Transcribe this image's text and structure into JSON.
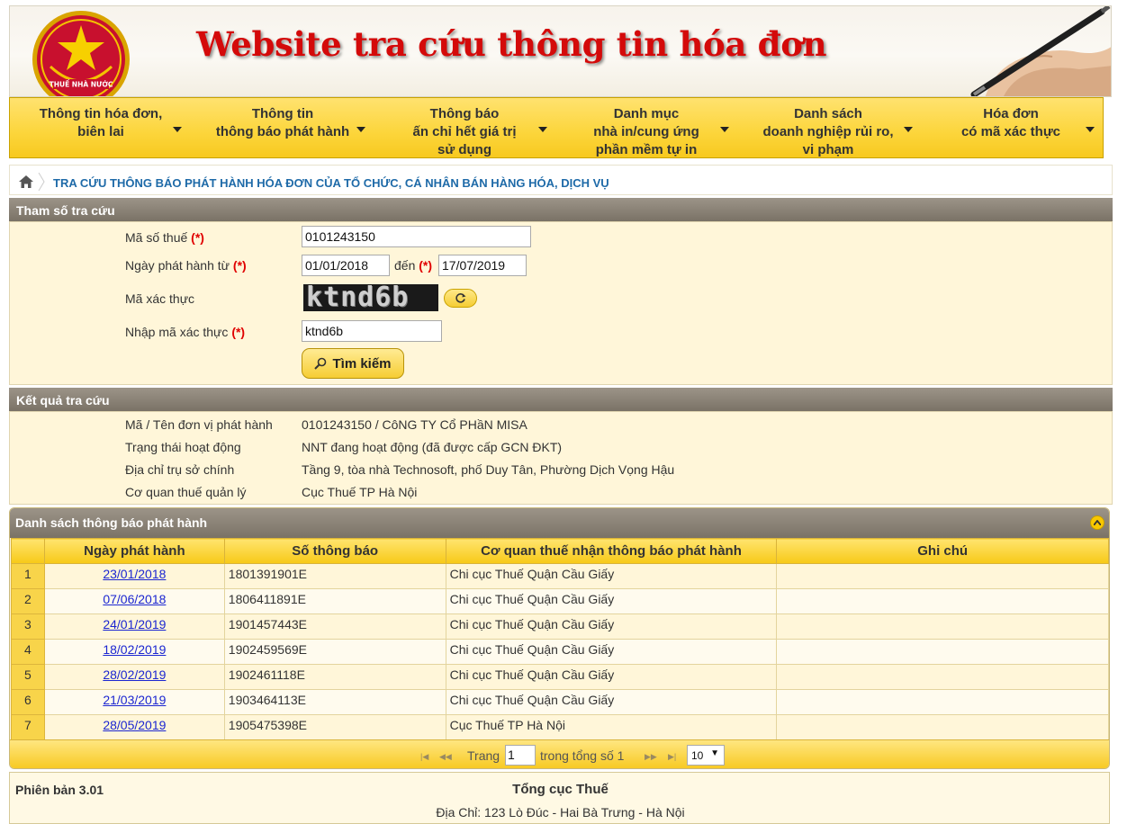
{
  "banner": {
    "title": "Website tra cứu thông tin hóa đơn",
    "emblem_text": "THUẾ NHÀ NƯỚC"
  },
  "nav": [
    {
      "label": "Thông tin hóa đơn,\nbiên lai"
    },
    {
      "label": "Thông tin\nthông báo phát hành"
    },
    {
      "label": "Thông báo\nấn chỉ hết giá trị\nsử dụng"
    },
    {
      "label": "Danh mục\nnhà in/cung ứng\nphần mềm tự in"
    },
    {
      "label": "Danh sách\ndoanh nghiệp rủi ro,\nvi phạm"
    },
    {
      "label": "Hóa đơn\ncó mã xác thực"
    }
  ],
  "breadcrumb": {
    "title": "TRA CỨU THÔNG BÁO PHÁT HÀNH HÓA ĐƠN CỦA TỔ CHỨC, CÁ NHÂN BÁN HÀNG HÓA, DỊCH VỤ"
  },
  "search": {
    "section_title": "Tham số tra cứu",
    "required_mark": "(*)",
    "tax_code_label": "Mã số thuế",
    "tax_code_value": "0101243150",
    "date_from_label": "Ngày phát hành từ",
    "date_from_value": "01/01/2018",
    "date_to_label": "đến",
    "date_to_value": "17/07/2019",
    "captcha_label": "Mã xác thực",
    "captcha_text": "ktnd6b",
    "captcha_input_label": "Nhập mã xác thực",
    "captcha_input_value": "ktnd6b",
    "search_button": "Tìm kiếm"
  },
  "result": {
    "section_title": "Kết quả tra cứu",
    "rows": [
      {
        "label": "Mã / Tên đơn vị phát hành",
        "value": "0101243150 / CôNG TY Cổ PHầN MISA"
      },
      {
        "label": "Trạng thái hoạt động",
        "value": "NNT đang hoạt động (đã được cấp GCN ĐKT)"
      },
      {
        "label": "Địa chỉ trụ sở chính",
        "value": "Tầng 9, tòa nhà Technosoft, phố Duy Tân, Phường Dịch Vọng Hậu"
      },
      {
        "label": "Cơ quan thuế quản lý",
        "value": "Cục Thuế TP Hà Nội"
      }
    ]
  },
  "list": {
    "title": "Danh sách thông báo phát hành",
    "columns": [
      "Ngày phát hành",
      "Số thông báo",
      "Cơ quan thuế nhận thông báo phát hành",
      "Ghi chú"
    ],
    "rows": [
      {
        "n": "1",
        "date": "23/01/2018",
        "number": "1801391901E",
        "agency": "Chi cục Thuế Quận Cầu Giấy",
        "note": ""
      },
      {
        "n": "2",
        "date": "07/06/2018",
        "number": "1806411891E",
        "agency": "Chi cục Thuế Quận Cầu Giấy",
        "note": ""
      },
      {
        "n": "3",
        "date": "24/01/2019",
        "number": "1901457443E",
        "agency": "Chi cục Thuế Quận Cầu Giấy",
        "note": ""
      },
      {
        "n": "4",
        "date": "18/02/2019",
        "number": "1902459569E",
        "agency": "Chi cục Thuế Quận Cầu Giấy",
        "note": ""
      },
      {
        "n": "5",
        "date": "28/02/2019",
        "number": "1902461118E",
        "agency": "Chi cục Thuế Quận Cầu Giấy",
        "note": ""
      },
      {
        "n": "6",
        "date": "21/03/2019",
        "number": "1903464113E",
        "agency": "Chi cục Thuế Quận Cầu Giấy",
        "note": ""
      },
      {
        "n": "7",
        "date": "28/05/2019",
        "number": "1905475398E",
        "agency": "Cục Thuế TP Hà Nội",
        "note": ""
      }
    ],
    "pager": {
      "page_label": "Trang",
      "page_value": "1",
      "total_label": "trong tổng số 1",
      "page_size": "10"
    }
  },
  "footer": {
    "version": "Phiên bản 3.01",
    "org": "Tổng cục Thuế",
    "address": "Địa Chỉ: 123 Lò Đúc - Hai Bà Trưng - Hà Nội"
  },
  "colors": {
    "accent_yellow": "#f7c91f",
    "banner_title_red": "#d40a0a",
    "section_bar_gray": "#8a8276",
    "link_blue": "#1b26d1",
    "required_red": "#e00000"
  }
}
